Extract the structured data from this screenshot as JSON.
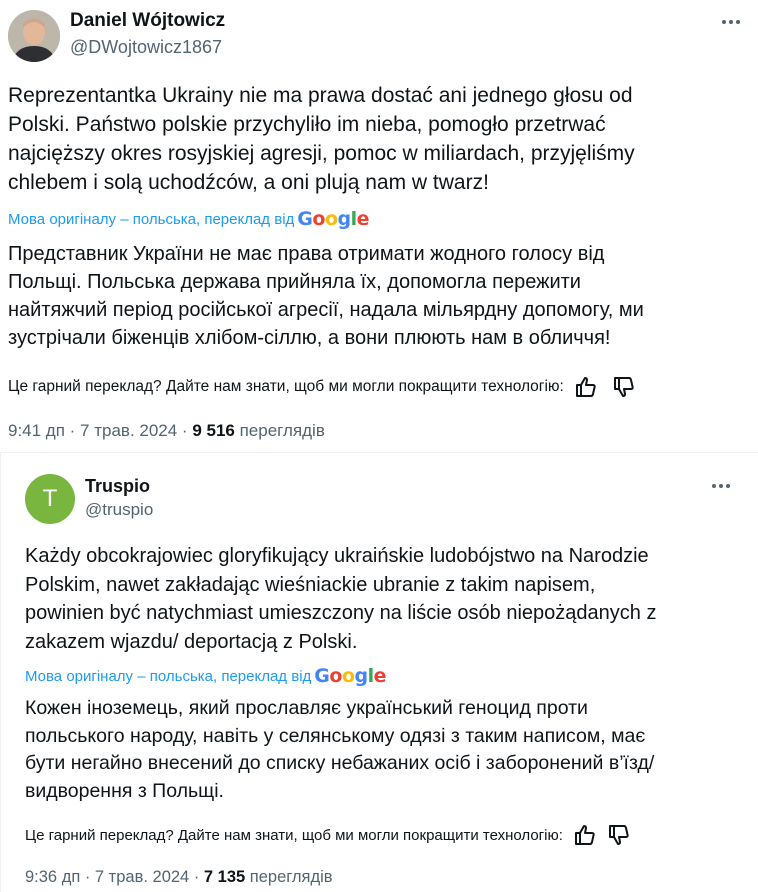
{
  "tweet1": {
    "author_name": "Daniel Wójtowicz",
    "handle": "@DWojtowicz1867",
    "text_lines": [
      "Reprezentantka Ukrainy nie ma prawa dostać ani jednego głosu od",
      "Polski. Państwo polskie przychyliło im nieba, pomogło przetrwać",
      "najcięższy okres rosyjskiej agresji, pomoc w miliardach, przyjęliśmy",
      "chlebem i solą uchodźców, a oni plują nam w twarz!"
    ],
    "translation_note": "Мова оригіналу – польська, переклад від",
    "google": "Google",
    "translated_lines": [
      "Представник України не має права отримати жодного голосу від",
      "Польщі. Польська держава прийняла їх, допомогла пережити",
      "найтяжчий період російської агресії, надала мільярдну допомогу, ми",
      "зустрічали біженців хлібом-сіллю, а вони плюють нам в обличчя!"
    ],
    "feedback": "Це гарний переклад? Дайте нам знати, щоб ми могли покращити технологію:",
    "time": "9:41 дп · 7 трав. 2024 · ",
    "views": "9 516",
    "views_label": " переглядів"
  },
  "tweet2": {
    "avatar_letter": "T",
    "author_name": "Truspio",
    "handle": "@truspio",
    "text_lines": [
      "Każdy obcokrajowiec gloryfikujący ukraińskie ludobójstwo na Narodzie",
      "Polskim, nawet zakładając wieśniackie ubranie z takim napisem,",
      "powinien być natychmiast umieszczony na liście osób niepożądanych z",
      "zakazem wjazdu/ deportacją z Polski."
    ],
    "translation_note": "Мова оригіналу – польська, переклад від",
    "google": "Google",
    "translated_lines": [
      "Кожен іноземець, який прославляє український геноцид проти",
      "польського народу, навіть у селянському одязі з таким написом, має",
      "бути негайно внесений до списку небажаних осіб і заборонений в’їзд/",
      "видворення з Польщі."
    ],
    "feedback": "Це гарний переклад? Дайте нам знати, щоб ми могли покращити технологію:",
    "time": "9:36 дп · 7 трав. 2024 · ",
    "views": "7 135",
    "views_label": " переглядів"
  },
  "icons": {
    "more": "more-dots-icon",
    "thumbs_up": "thumbs-up-icon",
    "thumbs_down": "thumbs-down-icon"
  },
  "colors": {
    "link": "#1d9bf0",
    "secondary_text": "#536471",
    "avatar_green": "#79b640"
  }
}
